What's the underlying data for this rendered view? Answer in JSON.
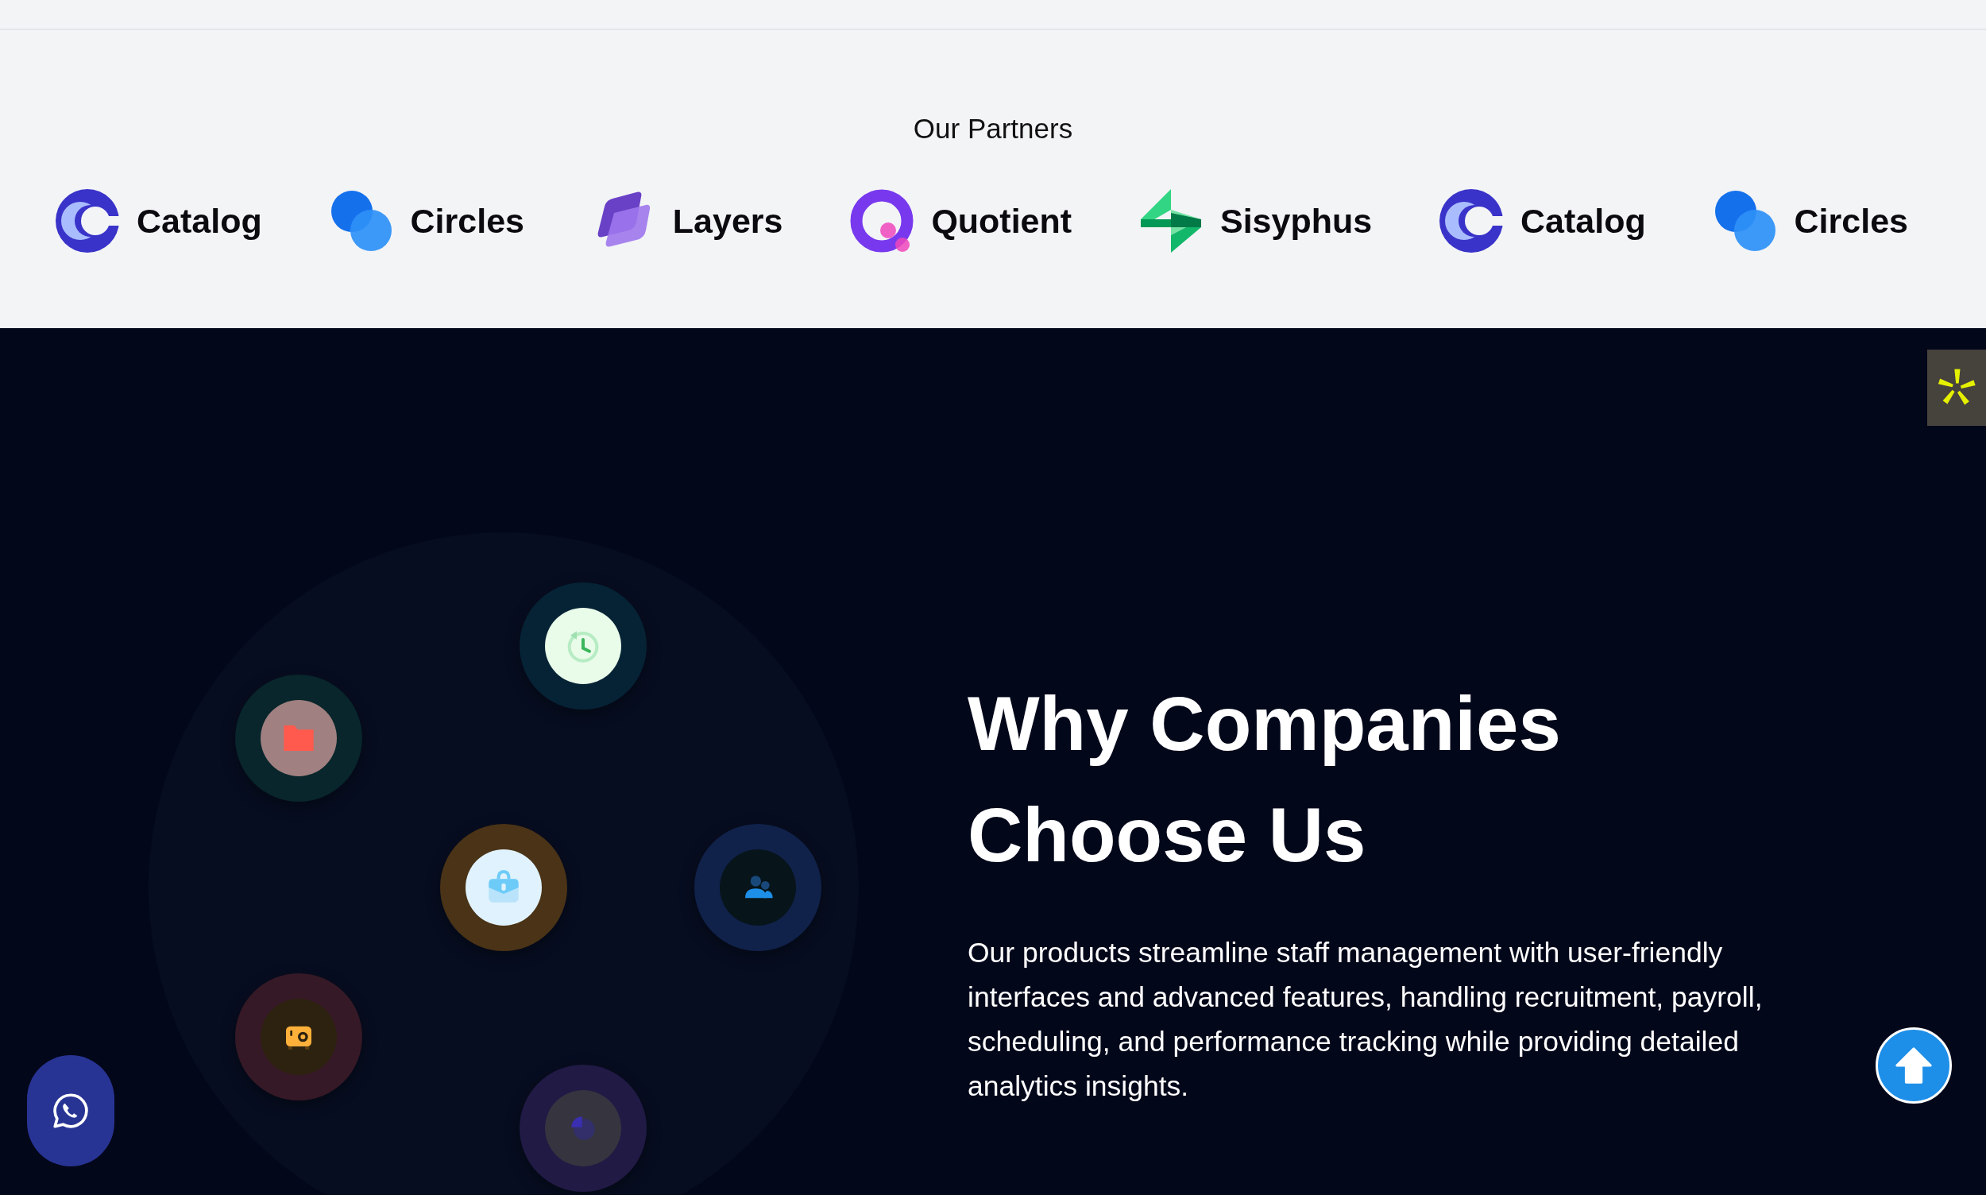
{
  "partners": {
    "title": "Our Partners",
    "items": [
      {
        "name": "Catalog",
        "kind": "catalog"
      },
      {
        "name": "Circles",
        "kind": "circles"
      },
      {
        "name": "Layers",
        "kind": "layers"
      },
      {
        "name": "Quotient",
        "kind": "quotient"
      },
      {
        "name": "Sisyphus",
        "kind": "sisyphus"
      },
      {
        "name": "Catalog",
        "kind": "catalog"
      },
      {
        "name": "Circles",
        "kind": "circles"
      }
    ]
  },
  "features": {
    "heading": "Why Companies Choose Us",
    "body": "Our products streamline staff management with user-friendly interfaces and advanced features, handling recruitment, payroll, scheduling, and performance tracking while providing detailed analytics insights.",
    "orbit": [
      {
        "kind": "clock"
      },
      {
        "kind": "folder"
      },
      {
        "kind": "briefcase"
      },
      {
        "kind": "people"
      },
      {
        "kind": "camera"
      },
      {
        "kind": "pie"
      }
    ]
  }
}
